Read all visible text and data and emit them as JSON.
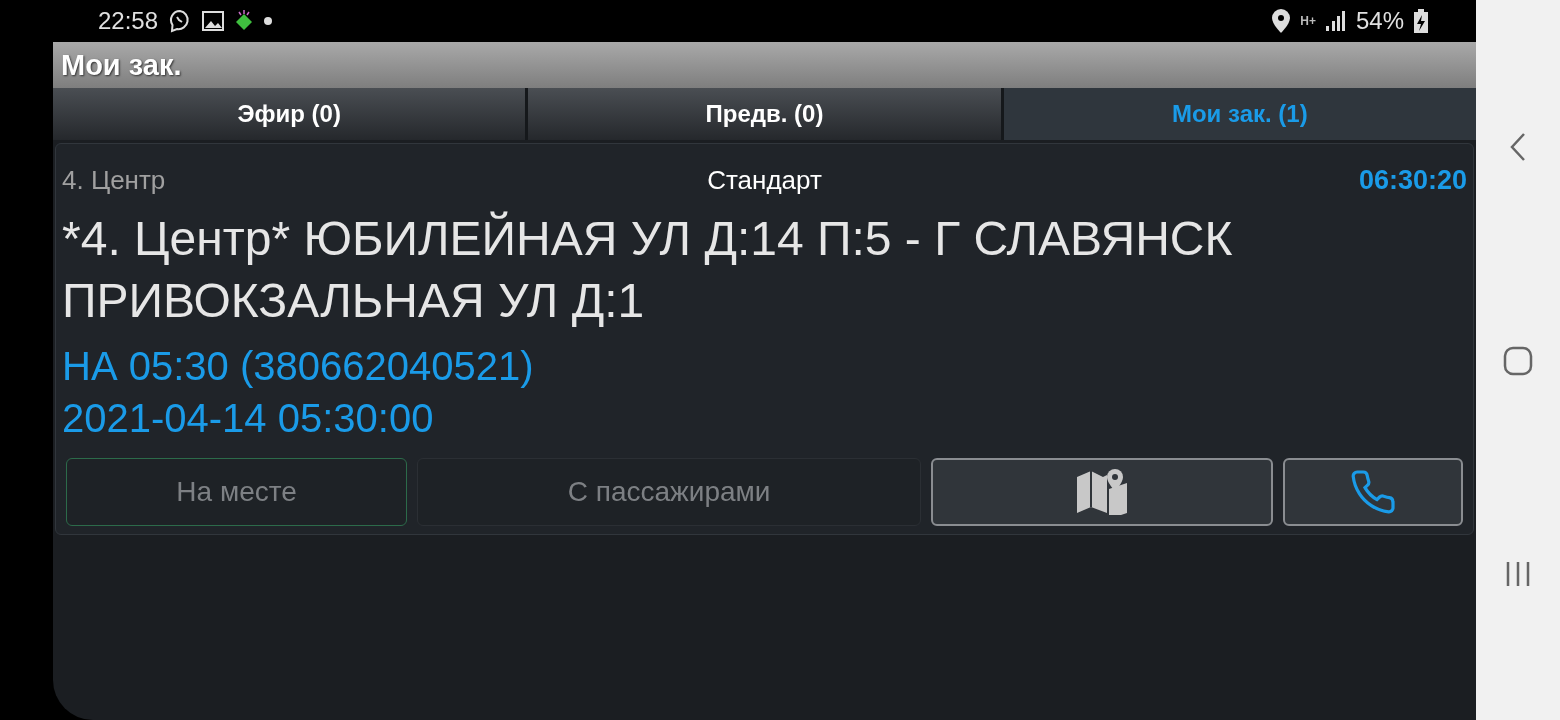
{
  "status_bar": {
    "time": "22:58",
    "network_type": "H+",
    "battery": "54%"
  },
  "title": "Мои зак.",
  "tabs": [
    {
      "label": "Эфир (0)",
      "selected": false
    },
    {
      "label": "Предв. (0)",
      "selected": false
    },
    {
      "label": "Мои зак. (1)",
      "selected": true
    }
  ],
  "order": {
    "district": "4. Центр",
    "tariff": "Стандарт",
    "timer": "06:30:20",
    "address": "*4. Центр* ЮБИЛЕЙНАЯ УЛ Д:14 П:5 - Г СЛАВЯНСК ПРИВОКЗАЛЬНАЯ УЛ Д:1",
    "pickup": "НА 05:30 (380662040521)",
    "datetime": "2021-04-14 05:30:00"
  },
  "buttons": [
    {
      "kind": "text",
      "label": "На месте",
      "disabled": true,
      "highlighted": true
    },
    {
      "kind": "text",
      "label": "С пассажирами",
      "disabled": true,
      "highlighted": false
    },
    {
      "kind": "map",
      "disabled": false,
      "highlighted": false
    },
    {
      "kind": "phone",
      "disabled": false,
      "highlighted": false
    }
  ]
}
